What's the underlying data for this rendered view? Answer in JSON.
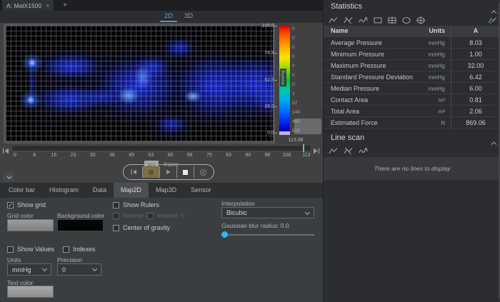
{
  "window": {
    "tab_title": "A: MatX1500",
    "close_glyph": "×",
    "add_glyph": "+"
  },
  "view_tabs": {
    "tab_2d": "2D",
    "tab_3d": "3D"
  },
  "colorbar": {
    "unit_label": "mmHg",
    "scale_labels": [
      "105.0",
      "78.8",
      "52.5",
      "26.3",
      "0.0"
    ],
    "histogram_counts": [
      "0",
      "0",
      "0",
      "0",
      "0",
      "0",
      "0",
      "1",
      "37",
      "149",
      "450",
      "925"
    ],
    "current_value": "113.06"
  },
  "timeline": {
    "ticks": [
      "0",
      "8",
      "15",
      "23",
      "30",
      "38",
      "45",
      "53",
      "60",
      "68",
      "75",
      "83",
      "90",
      "98",
      "106",
      "113"
    ],
    "unit_sec": "sec",
    "unit_frame": "frame"
  },
  "panel_tabs": {
    "items": [
      {
        "label": "Color bar"
      },
      {
        "label": "Histogram"
      },
      {
        "label": "Data"
      },
      {
        "label": "Map2D"
      },
      {
        "label": "Map3D"
      },
      {
        "label": "Sensor"
      }
    ],
    "active": "Map2D"
  },
  "settings": {
    "show_grid": "Show grid",
    "grid_color": "Grid color",
    "background_color": "Background color",
    "show_rulers": "Show Rulers",
    "inverse_x": "Inverse X",
    "inverse_y": "Inverse Y",
    "center_of_gravity": "Center of gravity",
    "interpolation_label": "Interpolation",
    "interpolation_value": "Bicubic",
    "gaussian_label": "Gaussian blur radius: 0.0",
    "show_values": "Show Values",
    "indexes": "Indexes",
    "units_label": "Units",
    "units_value": "mmHg",
    "precision_label": "Precision",
    "precision_value": "0",
    "text_color": "Text color",
    "check_glyph": "✓"
  },
  "statistics": {
    "title": "Statistics",
    "columns": {
      "name": "Name",
      "units": "Units",
      "a": "A"
    },
    "rows": [
      {
        "name": "Average Pressure",
        "units": "mmHg",
        "a": "8.03"
      },
      {
        "name": "Minimum Pressure",
        "units": "mmHg",
        "a": "1.00"
      },
      {
        "name": "Maximum Pressure",
        "units": "mmHg",
        "a": "32.00"
      },
      {
        "name": "Standard Pressure Deviation",
        "units": "mmHg",
        "a": "6.42"
      },
      {
        "name": "Median Pressure",
        "units": "mmHg",
        "a": "6.00"
      },
      {
        "name": "Contact Area",
        "units": "m²",
        "a": "0.81"
      },
      {
        "name": "Total Area",
        "units": "m²",
        "a": "2.06"
      },
      {
        "name": "Estimated Force",
        "units": "N",
        "a": "869.06"
      }
    ]
  },
  "line_scan": {
    "title": "Line scan",
    "empty_message": "There are no lines to display"
  },
  "colors": {
    "accent_cyan": "#41c4f2",
    "record_active": "#7a6f45",
    "heatmap_blue": "#1a2ce0",
    "panel_bg": "#2b2d30",
    "settings_bg": "#3b3e41"
  }
}
